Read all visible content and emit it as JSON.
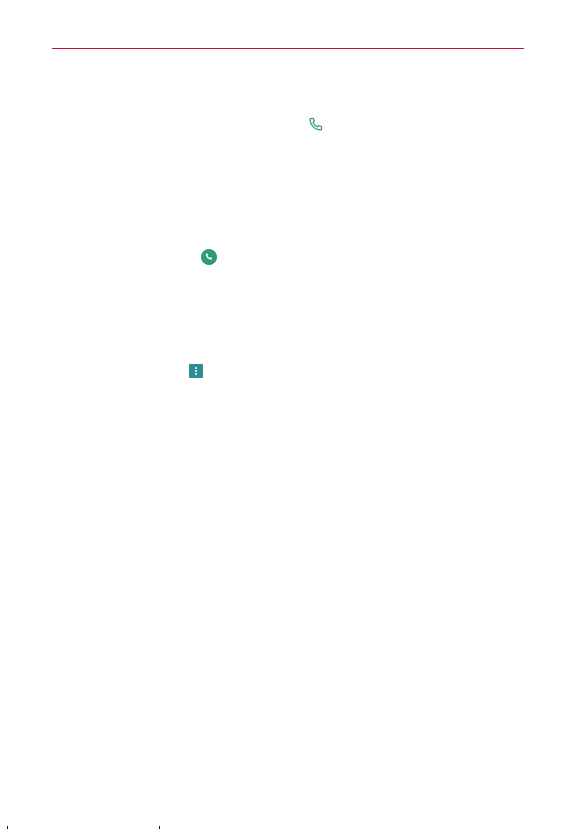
{
  "page": {
    "accent_color": "#c8102e"
  },
  "icons": {
    "phone_outline": "phone-outline-icon",
    "call_button": "call-circle-icon",
    "overflow_menu": "more-vertical-icon"
  },
  "colors": {
    "phone_icon": "#2e9a7d",
    "menu_icon": "#2c8d92"
  }
}
